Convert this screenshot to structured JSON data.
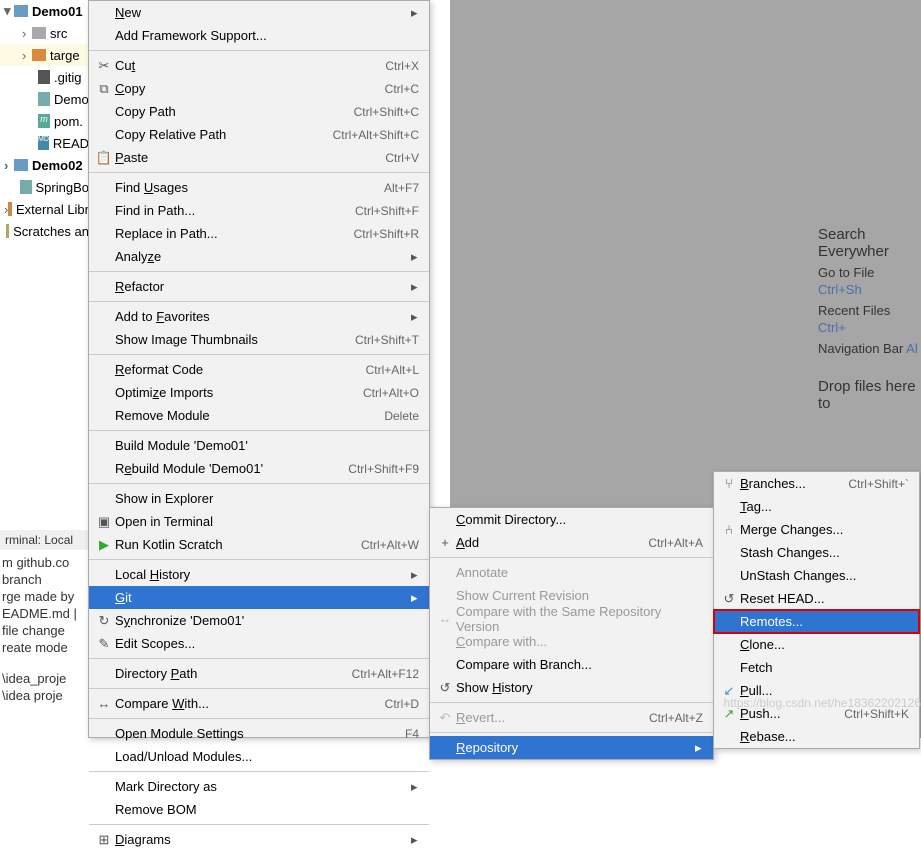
{
  "tree": {
    "demo01": "Demo01",
    "src": "src",
    "target": "targe",
    "gitig": ".gitig",
    "demo": "Demo",
    "pom": "pom.",
    "read": "READ",
    "demo02": "Demo02",
    "spring": "SpringBo",
    "extlib": "External Libr",
    "scratches": "Scratches an"
  },
  "terminal": {
    "header": "rminal:    Local",
    "l1": "m github.co",
    "l2": "branch",
    "l3": "rge made by",
    "l4": "EADME.md |",
    "l5": "file change",
    "l6": "reate mode",
    "l7": "\\idea_proje",
    "l8": "\\idea proje"
  },
  "menu1": [
    {
      "type": "item",
      "label": "New",
      "shortcut": "",
      "arrow": true,
      "underline": "N"
    },
    {
      "type": "item",
      "label": "Add Framework Support...",
      "shortcut": ""
    },
    {
      "type": "sep"
    },
    {
      "type": "item",
      "label": "Cut",
      "shortcut": "Ctrl+X",
      "icon": "cut",
      "underline": "t"
    },
    {
      "type": "item",
      "label": "Copy",
      "shortcut": "Ctrl+C",
      "icon": "copy",
      "underline": "C"
    },
    {
      "type": "item",
      "label": "Copy Path",
      "shortcut": "Ctrl+Shift+C"
    },
    {
      "type": "item",
      "label": "Copy Relative Path",
      "shortcut": "Ctrl+Alt+Shift+C"
    },
    {
      "type": "item",
      "label": "Paste",
      "shortcut": "Ctrl+V",
      "icon": "paste",
      "underline": "P"
    },
    {
      "type": "sep"
    },
    {
      "type": "item",
      "label": "Find Usages",
      "shortcut": "Alt+F7",
      "underline": "U"
    },
    {
      "type": "item",
      "label": "Find in Path...",
      "shortcut": "Ctrl+Shift+F"
    },
    {
      "type": "item",
      "label": "Replace in Path...",
      "shortcut": "Ctrl+Shift+R"
    },
    {
      "type": "item",
      "label": "Analyze",
      "shortcut": "",
      "arrow": true,
      "underline": "z"
    },
    {
      "type": "sep"
    },
    {
      "type": "item",
      "label": "Refactor",
      "shortcut": "",
      "arrow": true,
      "underline": "R"
    },
    {
      "type": "sep"
    },
    {
      "type": "item",
      "label": "Add to Favorites",
      "shortcut": "",
      "arrow": true,
      "underline": "F"
    },
    {
      "type": "item",
      "label": "Show Image Thumbnails",
      "shortcut": "Ctrl+Shift+T"
    },
    {
      "type": "sep"
    },
    {
      "type": "item",
      "label": "Reformat Code",
      "shortcut": "Ctrl+Alt+L",
      "underline": "R"
    },
    {
      "type": "item",
      "label": "Optimize Imports",
      "shortcut": "Ctrl+Alt+O",
      "underline": "z"
    },
    {
      "type": "item",
      "label": "Remove Module",
      "shortcut": "Delete"
    },
    {
      "type": "sep"
    },
    {
      "type": "item",
      "label": "Build Module 'Demo01'"
    },
    {
      "type": "item",
      "label": "Rebuild Module 'Demo01'",
      "shortcut": "Ctrl+Shift+F9",
      "underline": "e"
    },
    {
      "type": "sep"
    },
    {
      "type": "item",
      "label": "Show in Explorer"
    },
    {
      "type": "item",
      "label": "Open in Terminal",
      "icon": "terminal"
    },
    {
      "type": "item",
      "label": "Run Kotlin Scratch",
      "shortcut": "Ctrl+Alt+W",
      "icon": "run"
    },
    {
      "type": "sep"
    },
    {
      "type": "item",
      "label": "Local History",
      "shortcut": "",
      "arrow": true,
      "underline": "H"
    },
    {
      "type": "item",
      "label": "Git",
      "shortcut": "",
      "arrow": true,
      "underline": "G",
      "highlighted": true
    },
    {
      "type": "item",
      "label": "Synchronize 'Demo01'",
      "icon": "sync",
      "underline": "y"
    },
    {
      "type": "item",
      "label": "Edit Scopes...",
      "icon": "edit"
    },
    {
      "type": "sep"
    },
    {
      "type": "item",
      "label": "Directory Path",
      "shortcut": "Ctrl+Alt+F12",
      "underline": "P"
    },
    {
      "type": "sep"
    },
    {
      "type": "item",
      "label": "Compare With...",
      "shortcut": "Ctrl+D",
      "icon": "compare",
      "underline": "W"
    },
    {
      "type": "sep"
    },
    {
      "type": "item",
      "label": "Open Module Settings",
      "shortcut": "F4"
    },
    {
      "type": "item",
      "label": "Load/Unload Modules..."
    },
    {
      "type": "sep"
    },
    {
      "type": "item",
      "label": "Mark Directory as",
      "arrow": true
    },
    {
      "type": "item",
      "label": "Remove BOM"
    },
    {
      "type": "sep"
    },
    {
      "type": "item",
      "label": "Diagrams",
      "arrow": true,
      "icon": "diagrams",
      "underline": "D"
    }
  ],
  "menu2": [
    {
      "type": "item",
      "label": "Commit Directory...",
      "underline": "C"
    },
    {
      "type": "item",
      "label": "Add",
      "shortcut": "Ctrl+Alt+A",
      "icon": "plus",
      "underline": "A"
    },
    {
      "type": "sep"
    },
    {
      "type": "item",
      "label": "Annotate",
      "disabled": true
    },
    {
      "type": "item",
      "label": "Show Current Revision",
      "disabled": true
    },
    {
      "type": "item",
      "label": "Compare with the Same Repository Version",
      "icon": "compare",
      "disabled": true
    },
    {
      "type": "item",
      "label": "Compare with...",
      "disabled": true,
      "underline": "C"
    },
    {
      "type": "item",
      "label": "Compare with Branch..."
    },
    {
      "type": "item",
      "label": "Show History",
      "icon": "history",
      "underline": "H"
    },
    {
      "type": "sep"
    },
    {
      "type": "item",
      "label": "Revert...",
      "shortcut": "Ctrl+Alt+Z",
      "icon": "revert",
      "disabled": true,
      "underline": "R"
    },
    {
      "type": "sep"
    },
    {
      "type": "item",
      "label": "Repository",
      "underline": "R",
      "arrow": true,
      "highlighted": true
    }
  ],
  "menu3": [
    {
      "type": "item",
      "label": "Branches...",
      "shortcut": "Ctrl+Shift+`",
      "icon": "branch",
      "underline": "B"
    },
    {
      "type": "item",
      "label": "Tag...",
      "underline": "T"
    },
    {
      "type": "item",
      "label": "Merge Changes...",
      "icon": "merge"
    },
    {
      "type": "item",
      "label": "Stash Changes..."
    },
    {
      "type": "item",
      "label": "UnStash Changes..."
    },
    {
      "type": "item",
      "label": "Reset HEAD...",
      "icon": "reset"
    },
    {
      "type": "item",
      "label": "Remotes...",
      "highlighted": true,
      "boxed": true
    },
    {
      "type": "item",
      "label": "Clone...",
      "underline": "C"
    },
    {
      "type": "item",
      "label": "Fetch"
    },
    {
      "type": "item",
      "label": "Pull...",
      "icon": "pull",
      "underline": "P"
    },
    {
      "type": "item",
      "label": "Push...",
      "shortcut": "Ctrl+Shift+K",
      "icon": "push",
      "underline": "P"
    },
    {
      "type": "item",
      "label": "Rebase...",
      "underline": "R"
    }
  ],
  "welcome": {
    "l1a": "Search Everywher",
    "l2a": "Go to File ",
    "l2b": "Ctrl+Sh",
    "l3a": "Recent Files ",
    "l3b": "Ctrl+",
    "l4a": "Navigation Bar ",
    "l4b": "Al",
    "l5a": "Drop files here to"
  },
  "watermark": "https://blog.csdn.net/he18362202126"
}
